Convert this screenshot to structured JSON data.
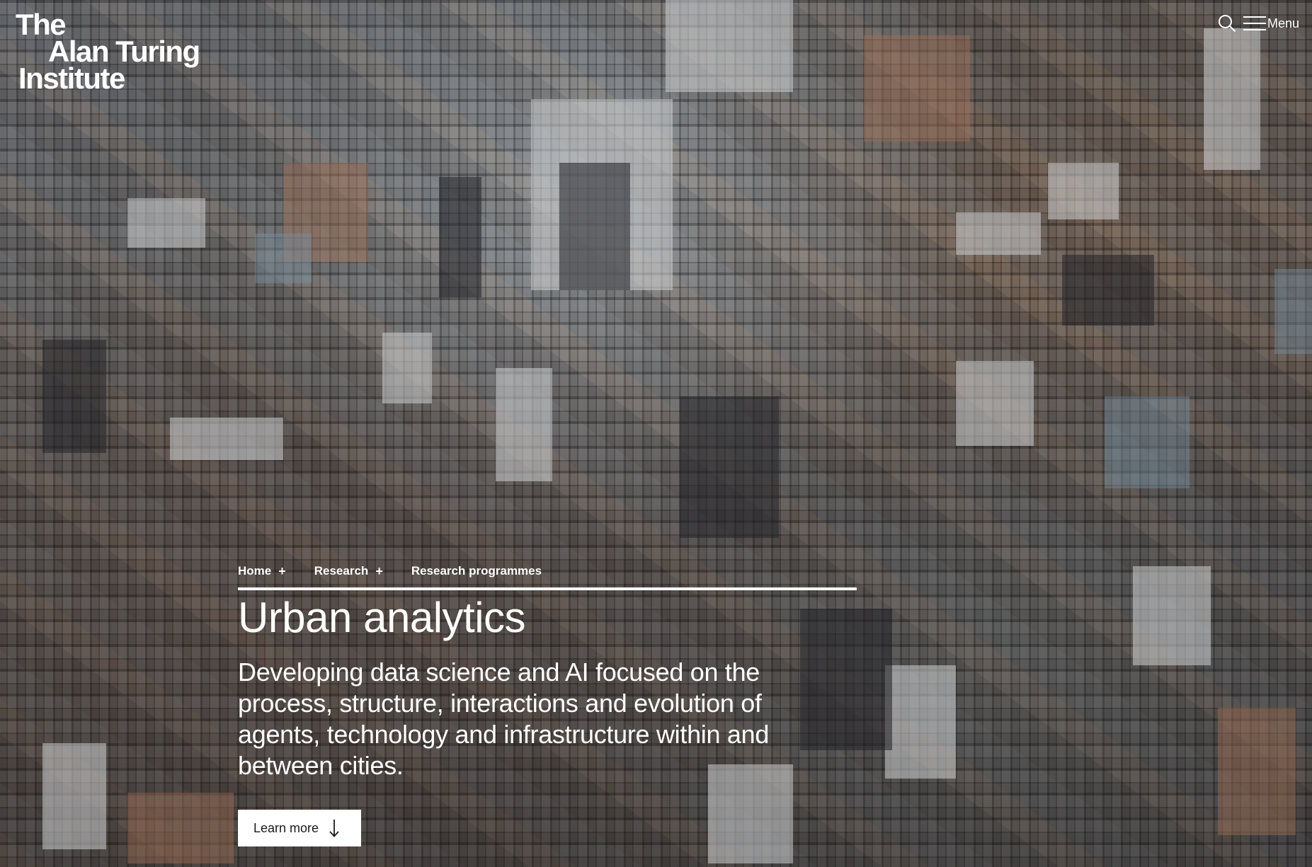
{
  "brand": {
    "logo_line1": "The",
    "logo_line2": "Alan Turing",
    "logo_line3": "Institute"
  },
  "header": {
    "search_icon": "search-icon",
    "menu_icon": "hamburger-icon",
    "menu_label": "Menu"
  },
  "breadcrumb": {
    "items": [
      {
        "label": "Home",
        "separator": "+"
      },
      {
        "label": "Research",
        "separator": "+"
      },
      {
        "label": "Research programmes"
      }
    ]
  },
  "hero": {
    "title": "Urban analytics",
    "description": "Developing data science and AI focused on the process, structure, interactions and evolution of agents, technology and infrastructure within and between cities.",
    "cta_label": "Learn more",
    "cta_icon": "arrow-down-icon",
    "background": "aerial city photograph"
  },
  "colors": {
    "text": "#ffffff",
    "button_bg": "#ffffff",
    "button_text": "#1a1a1a"
  }
}
